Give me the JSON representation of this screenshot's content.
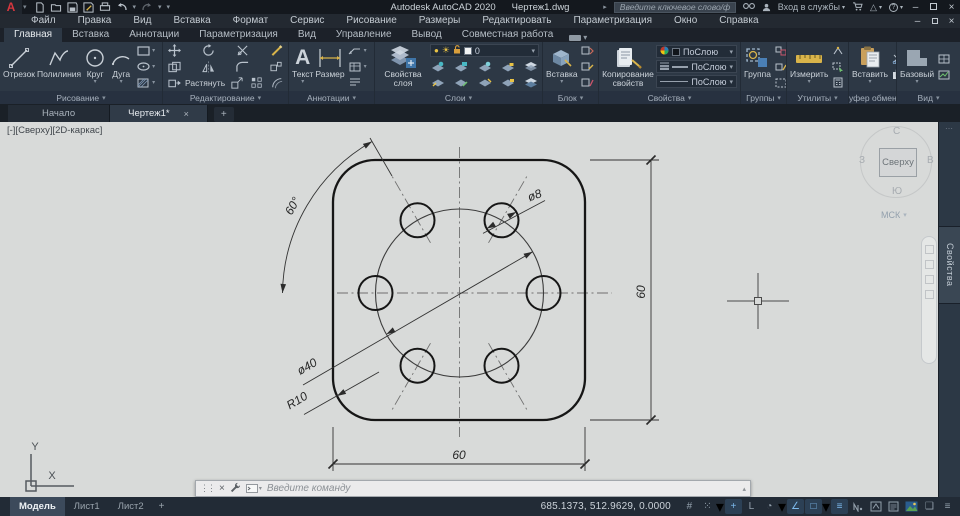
{
  "icons": {
    "close": "×",
    "minimize": "–",
    "caret": "▾",
    "caret_right": "▸",
    "caret_up": "▴",
    "plus": "+",
    "hamburger": "≡",
    "sun": "☀",
    "help": "?",
    "grip_dots": "⋮⋮",
    "ellipsis": "⋯",
    "angle_glyph": "∠",
    "ortho_glyph": "L",
    "grid_glyph": "#",
    "snap_glyph": "⁙",
    "polar_glyph": "◔",
    "osnap_glyph": "□",
    "dyninput_glyph": "+",
    "square_glyph": "❑"
  },
  "titlebar": {
    "app_title": "Autodesk AutoCAD 2020",
    "doc_title": "Чертеж1.dwg",
    "search_placeholder": "Введите ключевое слово/фразу",
    "signin_label": "Вход в службы"
  },
  "menubar": {
    "items": [
      "Файл",
      "Правка",
      "Вид",
      "Вставка",
      "Формат",
      "Сервис",
      "Рисование",
      "Размеры",
      "Редактировать",
      "Параметризация",
      "Окно",
      "Справка"
    ]
  },
  "ribbon": {
    "tabs": [
      "Главная",
      "Вставка",
      "Аннотации",
      "Параметризация",
      "Вид",
      "Управление",
      "Вывод",
      "Совместная работа"
    ],
    "active_tab": "Главная",
    "draw": {
      "label": "Рисование",
      "line": "Отрезок",
      "polyline": "Полилиния",
      "circle": "Круг",
      "arc": "Дуга"
    },
    "modify": {
      "label": "Редактирование",
      "stretch": "Растянуть"
    },
    "annotate": {
      "label": "Аннотации",
      "text": "Текст",
      "dimension": "Размер"
    },
    "layers": {
      "label": "Слои",
      "layer_properties": "Свойства\nслоя",
      "current_layer": "0"
    },
    "block": {
      "label": "Блок",
      "insert": "Вставка"
    },
    "properties": {
      "label": "Свойства",
      "match": "Копирование\nсвойств",
      "bylayer": "ПоСлою"
    },
    "groups": {
      "label": "Группы",
      "group": "Группа"
    },
    "utilities": {
      "label": "Утилиты",
      "measure": "Измерить"
    },
    "clipboard": {
      "label": "Буфер обмена",
      "paste": "Вставить"
    },
    "view": {
      "label": "Вид",
      "base": "Базовый"
    }
  },
  "doc_tabs": {
    "start": "Начало",
    "drawing": "Чертеж1*"
  },
  "canvas": {
    "viewport_label": "[-][Сверху][2D-каркас]",
    "viewcube": {
      "n": "С",
      "s": "Ю",
      "w": "З",
      "e": "В",
      "center": "Сверху",
      "wcs": "МСК"
    },
    "ucs": {
      "x": "X",
      "y": "Y"
    },
    "dimensions": {
      "angle": "60°",
      "hole": "ø8",
      "bolt_circle": "ø40",
      "fillet": "R10",
      "width": "60",
      "height": "60"
    }
  },
  "right_dock": {
    "properties_tab": "Свойства"
  },
  "command_line": {
    "placeholder": "Введите команду"
  },
  "statusbar": {
    "model": "Модель",
    "layout1": "Лист1",
    "layout2": "Лист2",
    "coords": "685.1373, 512.9629, 0.0000"
  },
  "colors": {
    "ribbon_bg": "#2d3845",
    "canvas_bg": "#d8dad9",
    "accent_blue": "#7db9ec",
    "autodesk_red": "#d6373f",
    "ruler_yellow": "#d9b44a"
  }
}
